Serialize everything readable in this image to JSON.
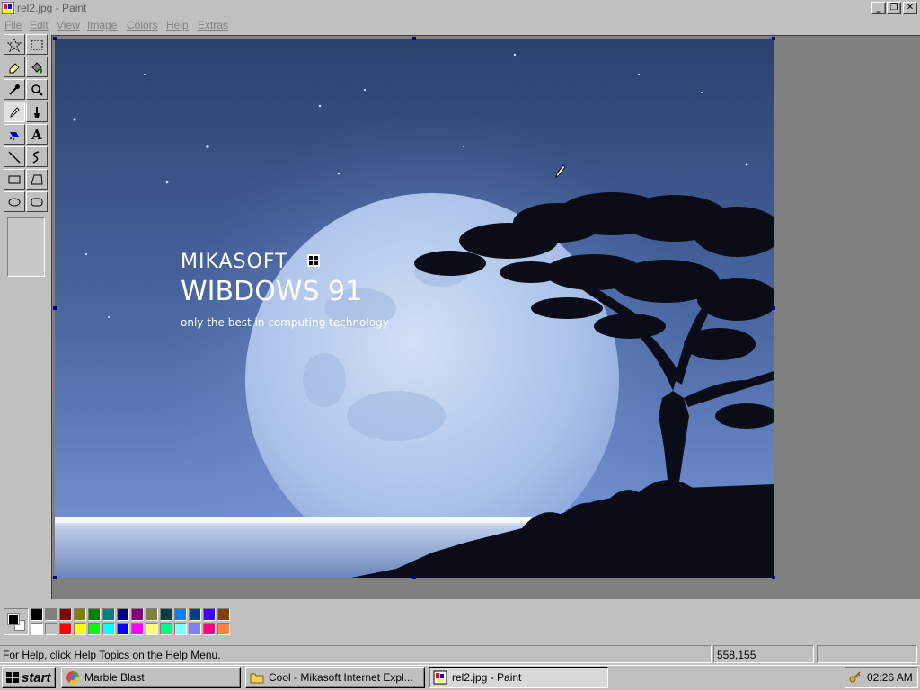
{
  "window": {
    "title": "rel2.jpg - Paint",
    "buttons": {
      "minimize": "_",
      "restore": "❐",
      "close": "✕"
    }
  },
  "menu": [
    "File",
    "Edit",
    "View",
    "Image",
    "Colors",
    "Help",
    "Extras"
  ],
  "tools": [
    {
      "name": "free-form-select",
      "icon": "star-select-icon"
    },
    {
      "name": "select",
      "icon": "rect-select-icon"
    },
    {
      "name": "eraser",
      "icon": "eraser-icon"
    },
    {
      "name": "fill",
      "icon": "paint-bucket-icon"
    },
    {
      "name": "pick-color",
      "icon": "eyedropper-icon"
    },
    {
      "name": "magnifier",
      "icon": "magnifier-icon"
    },
    {
      "name": "pencil",
      "icon": "pencil-icon",
      "selected": true
    },
    {
      "name": "brush",
      "icon": "brush-icon"
    },
    {
      "name": "airbrush",
      "icon": "airbrush-icon"
    },
    {
      "name": "text",
      "icon": "text-icon",
      "glyph": "A"
    },
    {
      "name": "line",
      "icon": "line-icon"
    },
    {
      "name": "curve",
      "icon": "curve-icon"
    },
    {
      "name": "rectangle",
      "icon": "rectangle-icon"
    },
    {
      "name": "polygon",
      "icon": "polygon-icon"
    },
    {
      "name": "ellipse",
      "icon": "ellipse-icon"
    },
    {
      "name": "rounded-rectangle",
      "icon": "rounded-rect-icon"
    }
  ],
  "canvas_image": {
    "brand": "MIKASOFT",
    "product": "WIBDOWS 91",
    "tagline": "only the best in computing technology",
    "colors": {
      "sky_top": "#2a4170",
      "sky_mid": "#4d6aa6",
      "sky_low": "#6f8ccc",
      "moon": "#b8cdee",
      "sea": "#c8d4ec",
      "silhouette": "#0a0d18"
    }
  },
  "palette": {
    "foreground": "#000000",
    "background": "#ffffff",
    "row1": [
      "#000000",
      "#808080",
      "#800000",
      "#808000",
      "#008000",
      "#008080",
      "#000080",
      "#800080",
      "#808040",
      "#004040",
      "#0080ff",
      "#004080",
      "#4000ff",
      "#804000"
    ],
    "row2": [
      "#ffffff",
      "#c0c0c0",
      "#ff0000",
      "#ffff00",
      "#00ff00",
      "#00ffff",
      "#0000ff",
      "#ff00ff",
      "#ffff80",
      "#00ff80",
      "#80ffff",
      "#8080ff",
      "#ff0080",
      "#ff8040"
    ]
  },
  "status": {
    "help_text": "For Help, click Help Topics on the Help Menu.",
    "coordinates": "558,155",
    "size": ""
  },
  "taskbar": {
    "start_label": "start",
    "buttons": [
      {
        "label": "Marble Blast",
        "icon": "marble-icon",
        "active": false
      },
      {
        "label": "Cool - Mikasoft Internet Expl...",
        "icon": "folder-icon",
        "active": false
      },
      {
        "label": "rel2.jpg - Paint",
        "icon": "paint-icon",
        "active": true
      }
    ],
    "clock": "02:26 AM"
  }
}
